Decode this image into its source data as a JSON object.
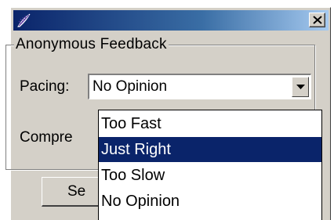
{
  "window": {
    "app_icon": "feather-app-icon",
    "close_icon": "close-x-icon"
  },
  "group": {
    "title": "Anonymous Feedback"
  },
  "pacing": {
    "label": "Pacing:",
    "selected_value": "No Opinion"
  },
  "comprehension": {
    "label_visible": "Compre"
  },
  "send_button": {
    "label_visible": "Se"
  },
  "dropdown": {
    "options": [
      "Too Fast",
      "Just Right",
      "Too Slow",
      "No Opinion"
    ],
    "highlighted_index": 1
  },
  "colors": {
    "selection": "#0a246a",
    "face": "#d4d0c8",
    "title_start": "#0a246a",
    "title_end": "#a6caf0"
  }
}
